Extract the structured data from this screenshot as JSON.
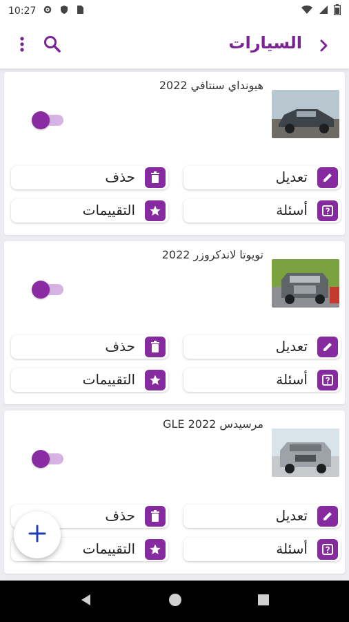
{
  "status_bar": {
    "time": "10:27"
  },
  "app_bar": {
    "title": "السيارات"
  },
  "cars": [
    {
      "title": "هيونداي سنتافي 2022",
      "enabled": true,
      "image_colors": {
        "sky": "#b8c6cf",
        "ground": "#6e6a64",
        "body": "#3d4449"
      },
      "buttons": {
        "edit": "تعديل",
        "delete": "حذف",
        "questions": "أسئلة",
        "ratings": "التقييمات"
      }
    },
    {
      "title": "تويوتا لاندكروزر 2022",
      "enabled": true,
      "image_colors": {
        "sky": "#7aa23f",
        "ground": "#8d8f93",
        "body": "#5f6468"
      },
      "buttons": {
        "edit": "تعديل",
        "delete": "حذف",
        "questions": "أسئلة",
        "ratings": "التقييمات"
      }
    },
    {
      "title": "مرسيدس GLE 2022",
      "enabled": true,
      "image_colors": {
        "sky": "#d9e3ea",
        "ground": "#c6cacd",
        "body": "#9da3a8"
      },
      "buttons": {
        "edit": "تعديل",
        "delete": "حذف",
        "questions": "أسئلة",
        "ratings": "التقييمات"
      }
    }
  ],
  "colors": {
    "accent": "#7b2296",
    "button_icon_bg": "#862a9f",
    "toggle_track": "#d7b3e3"
  }
}
